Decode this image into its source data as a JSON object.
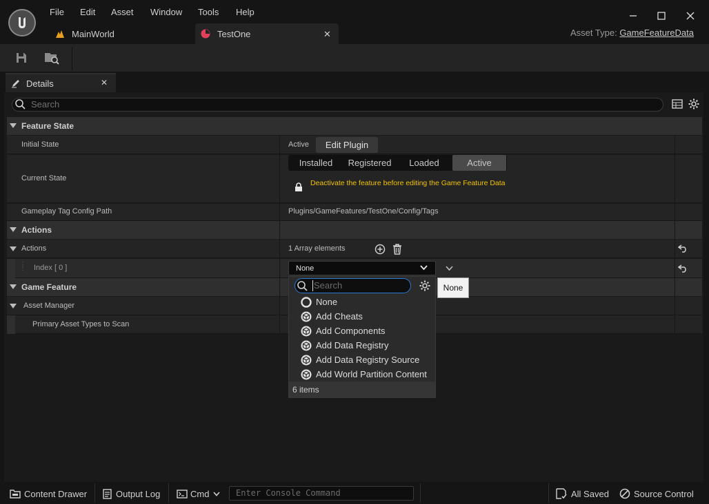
{
  "menu": [
    "File",
    "Edit",
    "Asset",
    "Window",
    "Tools",
    "Help"
  ],
  "tabs": {
    "main_world": "MainWorld",
    "test_one": "TestOne"
  },
  "asset_type": {
    "label": "Asset Type:",
    "value": "GameFeatureData"
  },
  "details": {
    "tab_label": "Details",
    "search_placeholder": "Search",
    "sections": {
      "feature_state": "Feature State",
      "actions": "Actions",
      "game_feature": "Game Feature"
    },
    "initial_state": {
      "label": "Initial State",
      "value": "Active",
      "button": "Edit Plugin"
    },
    "current_state": {
      "label": "Current State",
      "options": [
        "Installed",
        "Registered",
        "Loaded",
        "Active"
      ],
      "selected": "Active",
      "warning": "Deactivate the feature before editing the Game Feature Data"
    },
    "tag_config": {
      "label": "Gameplay Tag Config Path",
      "value": "Plugins/GameFeatures/TestOne/Config/Tags"
    },
    "actions_row": {
      "label": "Actions",
      "value": "1 Array elements"
    },
    "index_row": {
      "label": "Index [ 0 ]",
      "value": "None"
    },
    "asset_manager": {
      "label": "Asset Manager"
    },
    "primary_asset_types": {
      "label": "Primary Asset Types to Scan"
    }
  },
  "dropdown": {
    "search_placeholder": "Search",
    "items": [
      "None",
      "Add Cheats",
      "Add Components",
      "Add Data Registry",
      "Add Data Registry Source",
      "Add World Partition Content"
    ],
    "footer": "6 items"
  },
  "tooltip": "None",
  "statusbar": {
    "content_drawer": "Content Drawer",
    "output_log": "Output Log",
    "cmd": "Cmd",
    "console_placeholder": "Enter Console Command",
    "all_saved": "All Saved",
    "source_control": "Source Control"
  },
  "colors": {
    "warning": "#f2c200",
    "accent": "#2a7bd6",
    "testone_icon": "#e0405a",
    "mainworld_icon": "#e8a020"
  }
}
